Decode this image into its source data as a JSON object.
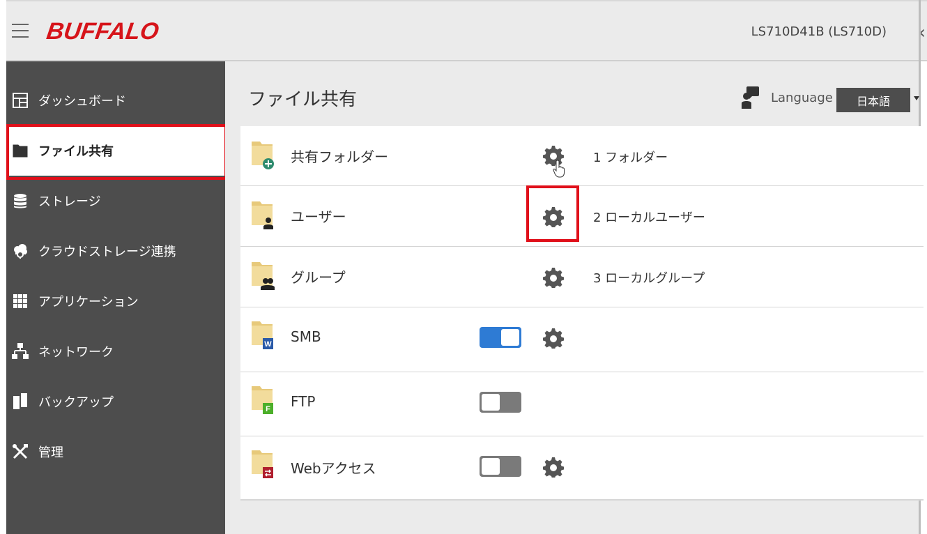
{
  "header": {
    "logo": "BUFFALO",
    "device_name": "LS710D41B (LS710D)"
  },
  "sidebar": {
    "items": [
      {
        "label": "ダッシュボード",
        "icon": "dashboard-icon"
      },
      {
        "label": "ファイル共有",
        "icon": "folder-icon",
        "active": true
      },
      {
        "label": "ストレージ",
        "icon": "storage-icon"
      },
      {
        "label": "クラウドストレージ連携",
        "icon": "cloud-icon"
      },
      {
        "label": "アプリケーション",
        "icon": "apps-grid-icon"
      },
      {
        "label": "ネットワーク",
        "icon": "network-icon"
      },
      {
        "label": "バックアップ",
        "icon": "backup-icon"
      },
      {
        "label": "管理",
        "icon": "tools-icon"
      }
    ]
  },
  "main": {
    "title": "ファイル共有",
    "language_label": "Language",
    "language_value": "日本語",
    "rows": [
      {
        "label": "共有フォルダー",
        "badge_color": "#2e8b6e",
        "has_gear": true,
        "info": "1 フォルダー"
      },
      {
        "label": "ユーザー",
        "badge_color": "#222222",
        "has_gear": true,
        "info": "2 ローカルユーザー"
      },
      {
        "label": "グループ",
        "badge_color": "#222222",
        "has_gear": true,
        "info": "3 ローカルグループ"
      },
      {
        "label": "SMB",
        "badge_color": "#2a5aa8",
        "badge_text": "W",
        "has_gear": true,
        "toggle": "on"
      },
      {
        "label": "FTP",
        "badge_color": "#4caf2a",
        "badge_text": "F",
        "toggle": "off"
      },
      {
        "label": "Webアクセス",
        "badge_color": "#b01f2e",
        "has_gear": true,
        "toggle": "off"
      }
    ]
  },
  "colors": {
    "accent_red": "#e0101a",
    "toggle_on": "#2e7bd4",
    "sidebar_bg": "#4d4d4d"
  }
}
